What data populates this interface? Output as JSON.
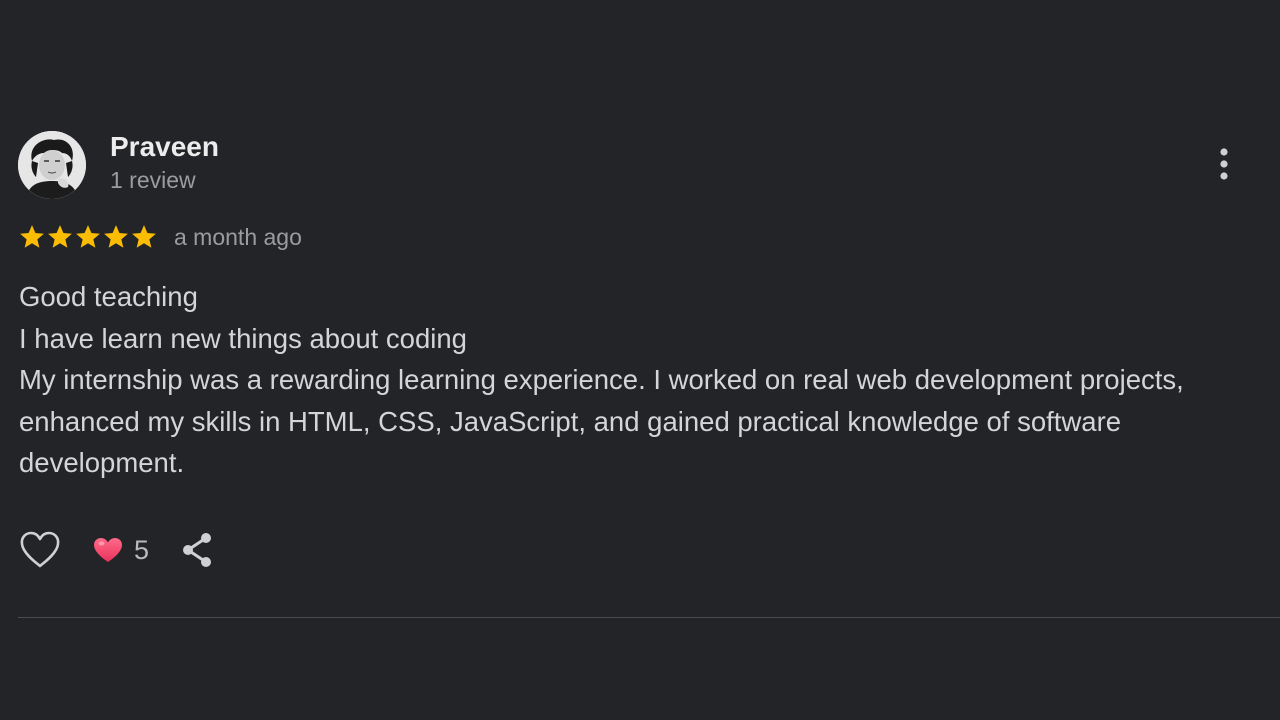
{
  "review": {
    "author": {
      "name": "Praveen",
      "review_count": "1 review",
      "avatar_icon": "user-photo-avatar"
    },
    "rating": 5,
    "rating_max": 5,
    "date": "a month ago",
    "text_lines": [
      "Good teaching",
      "I have learn new things about coding",
      "My internship was a rewarding learning experience. I worked on real web development projects, enhanced my skills in HTML, CSS, JavaScript, and gained practical knowledge of software development."
    ],
    "actions": {
      "like_icon": "heart-outline-icon",
      "reaction_icon": "heart-filled-icon",
      "reaction_count": "5",
      "share_icon": "share-icon",
      "more_icon": "more-vertical-icon"
    }
  },
  "colors": {
    "background": "#232428",
    "star": "#fbbc04",
    "reaction_heart": "#f0456a",
    "text_primary": "#ececec",
    "text_secondary": "#9a9ca0"
  }
}
